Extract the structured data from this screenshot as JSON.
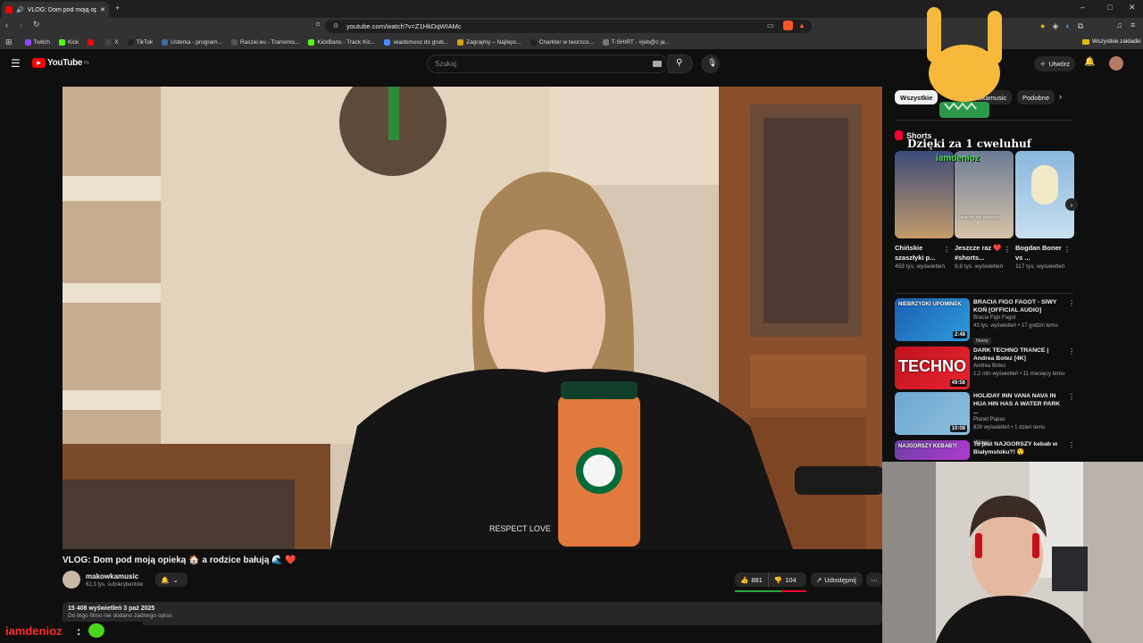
{
  "browser": {
    "tab_title": "VLOG: Dom pod moją opieką",
    "url": "youtube.com/watch?v=Z1HkDqWIAMc",
    "bookmarks": [
      {
        "label": "Twitch",
        "color": "#9146ff"
      },
      {
        "label": "Kick",
        "color": "#53fc18"
      },
      {
        "label": "",
        "color": "#ff0000"
      },
      {
        "label": "X",
        "color": "#444444"
      },
      {
        "label": "TikTok",
        "color": "#222222"
      },
      {
        "label": "Usterka - program...",
        "color": "#3a6ea5"
      },
      {
        "label": "Raszei.eu - Transmis...",
        "color": "#555555"
      },
      {
        "label": "KickBans - Track Kic...",
        "color": "#53fc18"
      },
      {
        "label": "wiadomosc do grub...",
        "color": "#4a8cff"
      },
      {
        "label": "Zagrajmy – Najleps...",
        "color": "#d4a017"
      },
      {
        "label": "Charkter w tworzco...",
        "color": "#222222"
      },
      {
        "label": "T-SHIRT - #jeb@c ja...",
        "color": "#777777"
      }
    ],
    "all_bookmarks": "Wszystkie zakładki"
  },
  "yt": {
    "logo": "YouTube",
    "region": "PL",
    "search_placeholder": "Szukaj",
    "create_label": "Utwórz"
  },
  "video": {
    "title": "VLOG: Dom pod moją opieką 🏠 a rodzice bałują 🌊 ❤️",
    "channel": "makowkamusic",
    "subscribers": "62,3 tys. subskrybentów",
    "likes": "881",
    "dislikes": "104",
    "share_label": "Udostępnij",
    "views_date": "15 408 wyświetleń  3 paź 2025",
    "description": "Do tego filmu nie dodano żadnego opisu.",
    "respect_text": "RESPECT LOVE"
  },
  "sidebar": {
    "chips": [
      "Wszystkie",
      "makowkamusic",
      "Podobne"
    ],
    "shorts_header": "Shorts",
    "overlay_text": "Dzięki za 1 cweluhuf",
    "overlay_name": "iamdenioz",
    "shorts": [
      {
        "title": "Chińskie szaszłyki p...",
        "views": "459 tys. wyświetleń"
      },
      {
        "title": "Jeszcze raz ❤️ #shorts...",
        "views": "9,8 tys. wyświetleń"
      },
      {
        "title": "Bogdan Boner vs ...",
        "views": "117 tys. wyświetleń"
      }
    ],
    "short2_caption": "Jeszcze raz powiedz",
    "recommendations": [
      {
        "title": "BRACIA FIGO FAGOT - SIWY KOŃ [OFFICIAL AUDIO]",
        "channel": "Bracia Figo Fagot",
        "meta": "43 tys. wyświetleń • 17 godzin temu",
        "badge": "Nowy",
        "duration": "2:48",
        "thumb_text": "NIEBRZYDKI UPOMINEK",
        "colors": [
          "#1a5fb4",
          "#2e9cdb"
        ]
      },
      {
        "title": "DARK TECHNO TRANCE | Andrea Botez [4K]",
        "channel": "Andrea Botez",
        "meta": "1,2 mln wyświetleń • 11 miesięcy temu",
        "badge": "",
        "duration": "49:58",
        "thumb_text": "TECHNO",
        "colors": [
          "#c0131f",
          "#e8242f"
        ]
      },
      {
        "title": "HOLIDAY INN VANA NAVA IN HUA HIN HAS A WATER PARK ...",
        "channel": "Planet Papas",
        "meta": "828 wyświetleń • 1 dzień temu",
        "badge": "Nowy",
        "duration": "10:08",
        "thumb_text": "",
        "colors": [
          "#6fa6cf",
          "#8cbfe0"
        ]
      },
      {
        "title": "To jest NAJGORSZY kebab w Białymstoku?! 😲",
        "channel": "",
        "meta": "",
        "badge": "",
        "duration": "",
        "thumb_text": "NAJGORSZY KEBAB?!",
        "colors": [
          "#6a3fa0",
          "#b23ad1"
        ]
      }
    ]
  },
  "chat": {
    "user": "iamdenioz",
    "separator": ":"
  }
}
